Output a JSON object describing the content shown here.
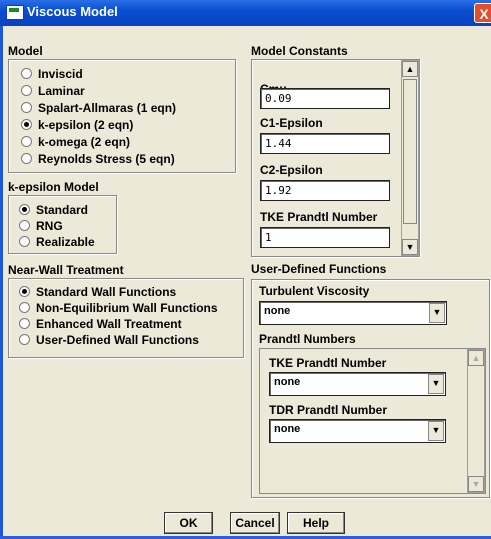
{
  "window": {
    "title": "Viscous Model",
    "close": "X"
  },
  "model": {
    "label": "Model",
    "options": [
      "Inviscid",
      "Laminar",
      "Spalart-Allmaras  (1 eqn)",
      "k-epsilon  (2 eqn)",
      "k-omega  (2 eqn)",
      "Reynolds Stress  (5 eqn)"
    ],
    "selected": "k-epsilon  (2 eqn)"
  },
  "kepsilon": {
    "label": "k-epsilon Model",
    "options": [
      "Standard",
      "RNG",
      "Realizable"
    ],
    "selected": "Standard"
  },
  "nearwall": {
    "label": "Near-Wall Treatment",
    "options": [
      "Standard Wall Functions",
      "Non-Equilibrium Wall Functions",
      "Enhanced Wall Treatment",
      "User-Defined Wall Functions"
    ],
    "selected": "Standard Wall Functions"
  },
  "constants": {
    "label": "Model Constants",
    "items": [
      {
        "name": "Cmu",
        "value": "0.09"
      },
      {
        "name": "C1-Epsilon",
        "value": "1.44"
      },
      {
        "name": "C2-Epsilon",
        "value": "1.92"
      },
      {
        "name": "TKE Prandtl Number",
        "value": "1"
      }
    ]
  },
  "udf": {
    "label": "User-Defined Functions",
    "turb_label": "Turbulent Viscosity",
    "turb_value": "none",
    "prandtl_label": "Prandtl Numbers",
    "tke_label": "TKE Prandtl Number",
    "tke_value": "none",
    "tdr_label": "TDR Prandtl Number",
    "tdr_value": "none"
  },
  "buttons": {
    "ok": "OK",
    "cancel": "Cancel",
    "help": "Help"
  }
}
